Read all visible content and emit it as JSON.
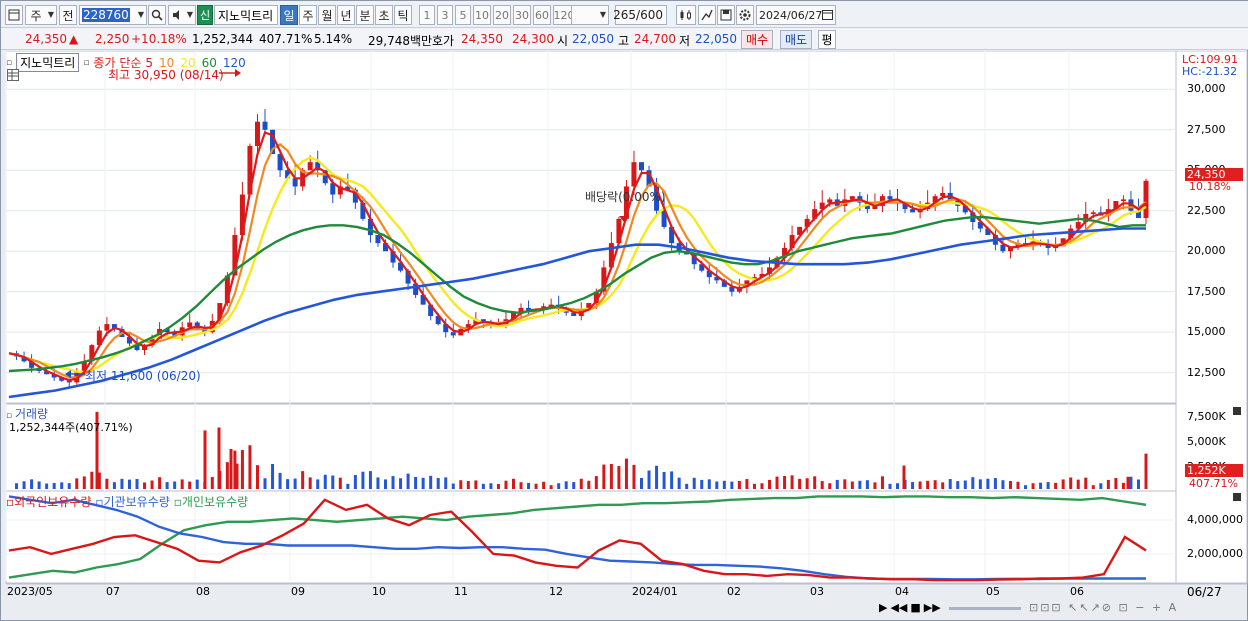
{
  "toolbar": {
    "menu_label": "주",
    "prev_label": "전",
    "stock_code": "228760",
    "stock_flag": "신",
    "stock_name": "지노믹트리",
    "period_tabs": [
      "일",
      "주",
      "월",
      "년",
      "분",
      "초",
      "틱"
    ],
    "selected_period": "일",
    "interval_buttons": [
      "1",
      "3",
      "5",
      "10",
      "20",
      "30",
      "60",
      "120"
    ],
    "count_value": "265",
    "count_max": "/600",
    "date_value": "2024/06/27"
  },
  "quote": {
    "price": "24,350",
    "change_arrow": "▲",
    "change": "2,250",
    "change_pct": "+10.18%",
    "volume": "1,252,344",
    "volume_ratio": "407.71%",
    "turnover": "5.14%",
    "amount": "29,748백만",
    "ask_label": "호가",
    "ask": "24,350",
    "bid": "24,300",
    "open_label": "시",
    "open": "22,050",
    "high_label": "고",
    "high": "24,700",
    "low_label": "저",
    "low": "22,050",
    "buy_label": "매수",
    "sell_label": "매도",
    "eval_label": "평"
  },
  "price_panel": {
    "name_box": "지노믹트리",
    "legend_prefix": "종가 단순",
    "ma_periods": [
      "5",
      "10",
      "20",
      "60",
      "120"
    ],
    "ma_colors": [
      "#e01919",
      "#f08a1e",
      "#f5ea1e",
      "#1e8a3a",
      "#2456d8"
    ],
    "max_label": "최고 30,950 (08/14)",
    "min_label": "최저 11,600 (06/20)",
    "dividend_label": "배당락(0.00%)",
    "lc_label": "LC:109.91",
    "hc_label": "HC:-21.32",
    "y_ticks": [
      "30,000",
      "27,500",
      "25,000",
      "22,500",
      "20,000",
      "17,500",
      "15,000",
      "12,500"
    ],
    "current_price_tag": "24,350",
    "current_pct_tag": "10.18%"
  },
  "volume_panel": {
    "title": "거래량",
    "sub": "1,252,344주(407.71%)",
    "y_ticks": [
      "7,500K",
      "5,000K",
      "2,500K"
    ],
    "current_tag": "1,252K",
    "pct_tag": "407.71%"
  },
  "holding_panel": {
    "series": [
      "외국인보유수량",
      "기관보유수량",
      "개인보유수량"
    ],
    "colors": [
      "#d81818",
      "#2f63d9",
      "#2f9a52"
    ],
    "y_ticks": [
      "4,000,000",
      "2,000,000"
    ]
  },
  "x_axis": {
    "labels": [
      "2023/05",
      "07",
      "08",
      "09",
      "10",
      "11",
      "12",
      "2024/01",
      "02",
      "03",
      "04",
      "05",
      "06"
    ],
    "end_label": "06/27"
  },
  "chart_data": {
    "type": "line",
    "title": "",
    "ylim": [
      10750,
      31500
    ],
    "price_close_path": [
      13700,
      13500,
      13200,
      12800,
      12600,
      12400,
      12200,
      12000,
      11900,
      12500,
      13200,
      14200,
      15100,
      15500,
      15200,
      14700,
      14300,
      13900,
      14200,
      14600,
      15200,
      15000,
      14800,
      15300,
      15600,
      15200,
      15000,
      15700,
      16800,
      18500,
      21000,
      23500,
      26500,
      28000,
      27500,
      26000,
      25000,
      24500,
      24000,
      25000,
      25500,
      25000,
      24200,
      23500,
      24000,
      23800,
      23000,
      22000,
      21000,
      20500,
      20000,
      19300,
      18800,
      18000,
      17300,
      16700,
      16000,
      15500,
      15000,
      14800,
      15200,
      15500,
      15800,
      15600,
      15400,
      15500,
      15800,
      16200,
      16500,
      16300,
      16400,
      16600,
      16700,
      16500,
      16200,
      16000,
      16400,
      16800,
      17500,
      19000,
      20500,
      22000,
      24000,
      25500,
      25000,
      24000,
      22500,
      21500,
      20500,
      20000,
      19800,
      19200,
      18800,
      18400,
      18200,
      17800,
      17500,
      17800,
      18200,
      18400,
      18600,
      19000,
      19600,
      20200,
      21000,
      21500,
      22000,
      22600,
      23000,
      23200,
      22800,
      23200,
      23400,
      23000,
      22600,
      22800,
      23400,
      23200,
      23000,
      22600,
      22400,
      22600,
      23000,
      23400,
      23600,
      23200,
      22800,
      22400,
      21800,
      21400,
      21000,
      20400,
      20000,
      20300,
      20500,
      20400,
      20600,
      20400,
      20200,
      20300,
      20800,
      21400,
      21800,
      22300,
      22400,
      22200,
      22600,
      23100,
      23200,
      22500,
      22050,
      24350
    ],
    "ma60_path": [
      12600,
      12650,
      12700,
      12800,
      12900,
      13050,
      13250,
      13450,
      13700,
      14000,
      14400,
      14800,
      15300,
      15900,
      16600,
      17400,
      18200,
      18900,
      19500,
      20100,
      20600,
      21000,
      21300,
      21500,
      21600,
      21600,
      21500,
      21300,
      21000,
      20500,
      19900,
      19200,
      18500,
      17800,
      17200,
      16800,
      16500,
      16300,
      16200,
      16300,
      16400,
      16600,
      16800,
      17100,
      17500,
      18000,
      18600,
      19100,
      19600,
      19900,
      20000,
      19900,
      19700,
      19500,
      19300,
      19200,
      19200,
      19400,
      19700,
      20000,
      20200,
      20400,
      20600,
      20800,
      20900,
      21000,
      21100,
      21300,
      21500,
      21700,
      21900,
      22000,
      22100,
      22100,
      22000,
      21900,
      21800,
      21700,
      21800,
      21900,
      22000,
      21900,
      21700,
      21500,
      21600,
      21600
    ],
    "ma120_path": [
      11000,
      11200,
      11400,
      11700,
      12000,
      12400,
      12800,
      13300,
      13900,
      14500,
      15100,
      15700,
      16200,
      16600,
      17000,
      17300,
      17500,
      17700,
      17900,
      18100,
      18300,
      18600,
      18900,
      19200,
      19600,
      20000,
      20200,
      20400,
      20400,
      20200,
      19900,
      19600,
      19400,
      19300,
      19200,
      19200,
      19200,
      19300,
      19500,
      19800,
      20100,
      20400,
      20600,
      20800,
      21000,
      21100,
      21200,
      21300,
      21400,
      21400
    ],
    "volume_highlight_k": [
      7900,
      6000,
      6300,
      4100,
      2600,
      2400,
      1252
    ],
    "holding": {
      "foreign_ylim": [
        0,
        5000000
      ],
      "y_ticks": [
        4000000,
        2000000
      ]
    }
  }
}
